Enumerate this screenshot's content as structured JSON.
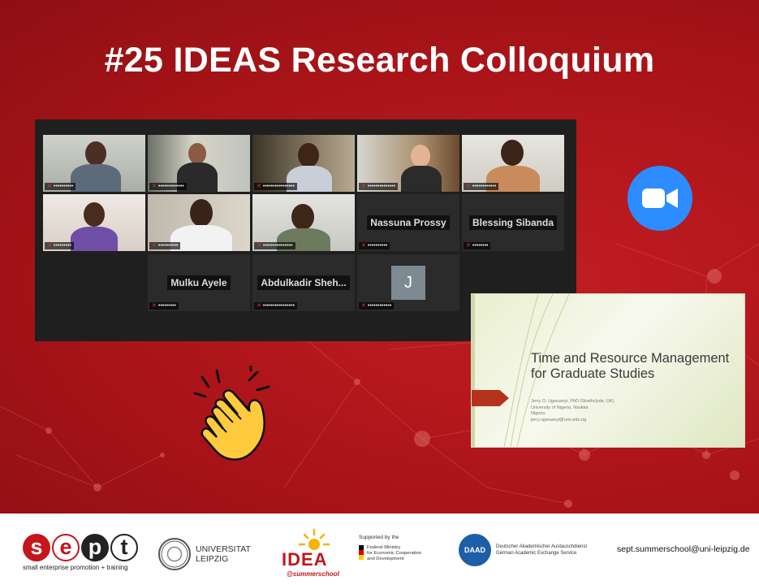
{
  "slide": {
    "title": "#25 IDEAS Research Colloquium",
    "background_color": "#b5161b"
  },
  "zoom_gallery": {
    "tiles": [
      {
        "type": "video",
        "name": "",
        "active": false
      },
      {
        "type": "video",
        "name": "",
        "active": false
      },
      {
        "type": "video",
        "name": "",
        "active": true
      },
      {
        "type": "video",
        "name": "",
        "active": false
      },
      {
        "type": "video",
        "name": "",
        "active": false
      },
      {
        "type": "video",
        "name": "",
        "active": false
      },
      {
        "type": "video",
        "name": "",
        "active": false
      },
      {
        "type": "video",
        "name": "",
        "active": false
      },
      {
        "type": "name",
        "name": "Nassuna Prossy",
        "active": false
      },
      {
        "type": "name",
        "name": "Blessing Sibanda",
        "active": false
      },
      {
        "type": "name",
        "name": "Mulku Ayele",
        "active": false
      },
      {
        "type": "name",
        "name": "Abdulkadir Sheh...",
        "active": false
      },
      {
        "type": "avatar",
        "name": "J",
        "active": false
      }
    ]
  },
  "zoom_icon": {
    "icon": "video-camera-icon",
    "color": "#2d8cff"
  },
  "presentation": {
    "title": "Time and Resource Management for Graduate Studies",
    "author": "Jerry O. Ugwuanyi, PhD (Strathclyde, UK)",
    "affiliation": "University of Nigeria, Nsukka",
    "country": "Nigeria",
    "email": "jerry.ugwuanyi@unn.edu.ng"
  },
  "emoji": {
    "icon": "clapping-hands-icon"
  },
  "footer": {
    "sept_letters": [
      "s",
      "e",
      "p",
      "t"
    ],
    "sept_tagline": "small enterprise promotion + training",
    "university": [
      "UNIVERSITAT",
      "LEIPZIG"
    ],
    "idea_word": "IDEA",
    "idea_sub": "@summerschool",
    "bmz_supported": "Supported by the",
    "bmz_name": [
      "Federal Ministry",
      "for Economic Cooperation",
      "and Development"
    ],
    "daad_badge": "DAAD",
    "daad_name": [
      "Deutscher Akademischer Austauschdienst",
      "German Academic Exchange Service"
    ],
    "contact_email": "sept.summerschool@uni-leipzig.de"
  }
}
